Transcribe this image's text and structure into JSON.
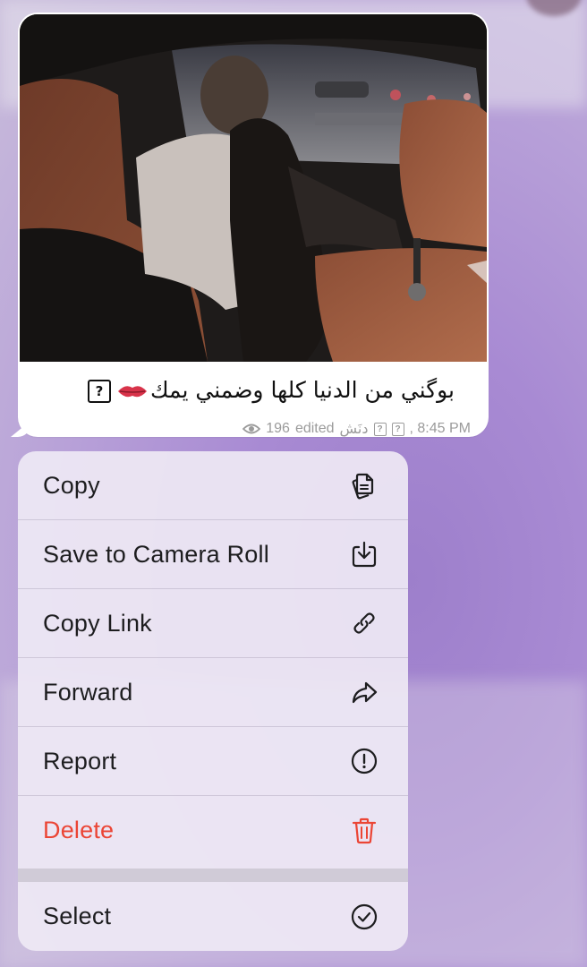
{
  "message": {
    "caption": "بوگني من الدنيا كلها وضمني يمك",
    "caption_unknown_glyph": "?",
    "views": "196",
    "edited_label": "edited",
    "author": "دنَش",
    "meta_unknown_glyph": "?",
    "time": ", 8:45 PM"
  },
  "menu": {
    "items": [
      {
        "label": "Copy",
        "icon": "copy-icon"
      },
      {
        "label": "Save to Camera Roll",
        "icon": "save-download-icon"
      },
      {
        "label": "Copy Link",
        "icon": "link-icon"
      },
      {
        "label": "Forward",
        "icon": "forward-arrow-icon"
      },
      {
        "label": "Report",
        "icon": "report-exclamation-icon"
      },
      {
        "label": "Delete",
        "icon": "trash-icon",
        "color": "#eb4535"
      },
      {
        "label": "Select",
        "icon": "checkmark-circle-icon"
      }
    ]
  },
  "colors": {
    "destructive": "#eb4535",
    "menu_text": "#1d1d1f",
    "meta_text": "#9b9b9b",
    "background": "#a88ad3"
  }
}
